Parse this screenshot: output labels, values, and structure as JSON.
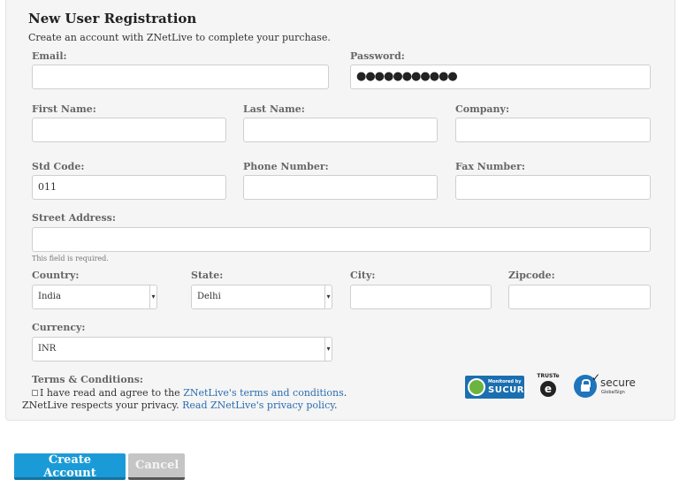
{
  "form": {
    "title": "New User Registration",
    "subtitle": "Create an account with ZNetLive to complete your purchase.",
    "email": {
      "label": "Email:",
      "value": ""
    },
    "password": {
      "label": "Password:",
      "value": "●●●●●●●●●●●"
    },
    "first_name": {
      "label": "First Name:",
      "value": ""
    },
    "last_name": {
      "label": "Last Name:",
      "value": ""
    },
    "company": {
      "label": "Company:",
      "value": ""
    },
    "std_code": {
      "label": "Std Code:",
      "value": "011"
    },
    "phone": {
      "label": "Phone Number:",
      "value": ""
    },
    "fax": {
      "label": "Fax Number:",
      "value": ""
    },
    "street": {
      "label": "Street Address:",
      "value": "",
      "error": "This field is required."
    },
    "country": {
      "label": "Country:",
      "value": "India"
    },
    "state": {
      "label": "State:",
      "value": "Delhi"
    },
    "city": {
      "label": "City:",
      "value": ""
    },
    "zipcode": {
      "label": "Zipcode:",
      "value": ""
    },
    "currency": {
      "label": "Currency:",
      "value": "INR"
    },
    "terms": {
      "label": "Terms & Conditions:",
      "line1_prefix": "I have read and agree to the ",
      "line1_link": "ZNetLive's terms and conditions",
      "line1_suffix": ".",
      "line2_prefix": "ZNetLive respects your privacy. ",
      "line2_link": "Read ZNetLive's privacy policy",
      "line2_suffix": "."
    }
  },
  "badges": {
    "sucuri_small": "Monitored by",
    "sucuri_brand": "SUCURI",
    "truste": "TRUSTe",
    "secure_word": "secure",
    "secure_sub": "GlobalSign"
  },
  "actions": {
    "create_label": "Create Account",
    "cancel_label": "Cancel"
  },
  "colors": {
    "primary": "#1a9bd7",
    "link": "#2a6db0",
    "panel_bg": "#f5f5f5"
  }
}
